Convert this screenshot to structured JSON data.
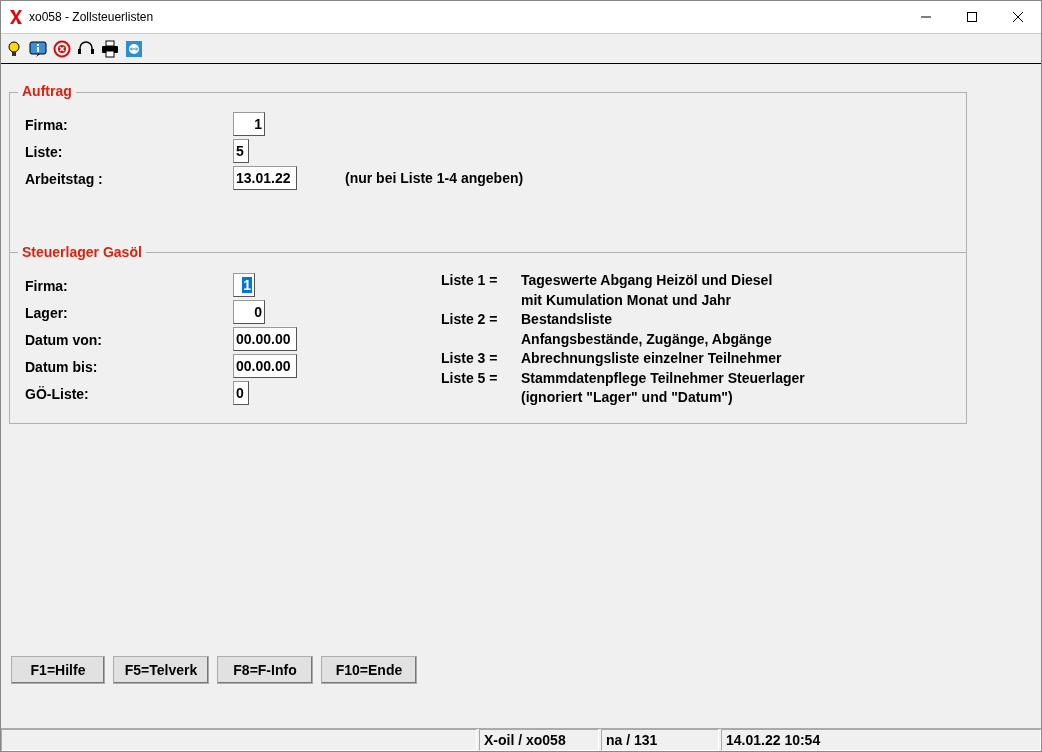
{
  "window": {
    "title": "xo058 - Zollsteuerlisten"
  },
  "groups": [
    {
      "title": "Auftrag",
      "fields": [
        {
          "label": "Firma:",
          "value": "1",
          "selected": false
        },
        {
          "label": "Liste:",
          "value": "5",
          "selected": false
        },
        {
          "label": "Arbeitstag :",
          "value": "13.01.22",
          "selected": false
        }
      ],
      "note": "(nur bei Liste 1-4 angeben)"
    },
    {
      "title": "Steuerlager Gasöl",
      "fields": [
        {
          "label": "Firma:",
          "value": "1",
          "selected": true
        },
        {
          "label": "Lager:",
          "value": "0",
          "selected": false
        },
        {
          "label": "Datum von:",
          "value": "00.00.00",
          "selected": false
        },
        {
          "label": "Datum bis:",
          "value": "00.00.00",
          "selected": false
        },
        {
          "label": "GÖ-Liste:",
          "value": "0",
          "selected": false
        }
      ],
      "legend": [
        {
          "key": "Liste 1 =",
          "lines": [
            "Tageswerte Abgang Heizöl und Diesel",
            "mit Kumulation Monat und Jahr"
          ]
        },
        {
          "key": "Liste 2 =",
          "lines": [
            "Bestandsliste",
            "Anfangsbestände, Zugänge, Abgänge"
          ]
        },
        {
          "key": "Liste 3 =",
          "lines": [
            "Abrechnungsliste einzelner Teilnehmer"
          ]
        },
        {
          "key": "Liste 5 =",
          "lines": [
            "Stammdatenpflege Teilnehmer Steuerlager",
            "(ignoriert \"Lager\" und \"Datum\")"
          ]
        }
      ]
    }
  ],
  "buttons": [
    "F1=Hilfe",
    "F5=Telverk",
    "F8=F-Info",
    "F10=Ende"
  ],
  "status_bar": [
    "X-oil / xo058",
    "na / 131",
    "14.01.22 10:54"
  ]
}
